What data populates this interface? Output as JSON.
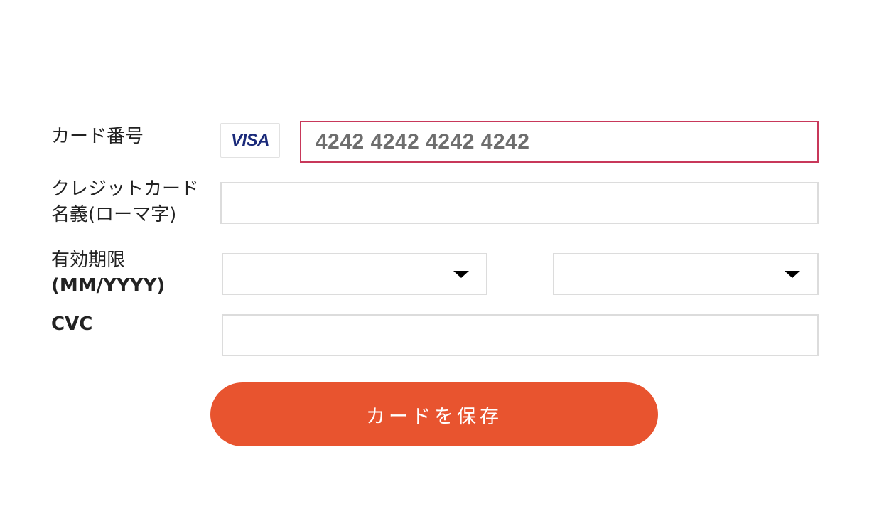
{
  "form": {
    "card_number": {
      "label": "カード番号",
      "brand": "VISA",
      "value": "4242 4242 4242 4242"
    },
    "holder_name": {
      "label_line1": "クレジットカード",
      "label_line2": "名義(ローマ字)",
      "value": ""
    },
    "expiry": {
      "label_line1": "有効期限",
      "label_line2": "(MM/YYYY)",
      "month_value": "",
      "year_value": ""
    },
    "cvc": {
      "label": "CVC",
      "value": ""
    },
    "save_label": "カードを保存"
  },
  "colors": {
    "accent": "#e8542f",
    "focus_border": "#c8385a",
    "field_border": "#dcdcdc",
    "visa_blue": "#1a2a7a"
  },
  "icons": {
    "brand_logo": "visa-logo",
    "select_caret": "caret-down-icon"
  }
}
